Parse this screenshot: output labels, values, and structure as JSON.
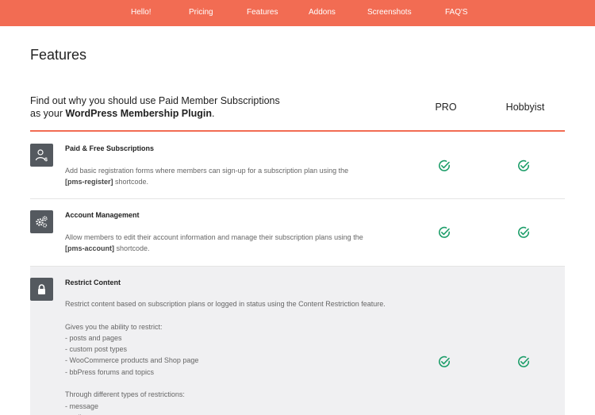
{
  "nav": {
    "items": [
      {
        "label": "Hello!"
      },
      {
        "label": "Pricing"
      },
      {
        "label": "Features"
      },
      {
        "label": "Addons"
      },
      {
        "label": "Screenshots"
      },
      {
        "label": "FAQ'S"
      }
    ]
  },
  "page": {
    "title": "Features"
  },
  "intro": {
    "line1": "Find out why you should use Paid Member Subscriptions",
    "line2_prefix": "as your ",
    "line2_strong": "WordPress Membership Plugin",
    "line2_suffix": "."
  },
  "columns": {
    "pro": "PRO",
    "hobbyist": "Hobbyist"
  },
  "features": [
    {
      "title": "Paid & Free Subscriptions",
      "desc_before": "Add basic registration forms where members can sign-up for a subscription plan using the",
      "shortcode": "[pms-register]",
      "desc_after": " shortcode.",
      "icon": "user-dollar-icon"
    },
    {
      "title": "Account Management",
      "desc_before": "Allow members to edit their account information and manage their subscription plans using the",
      "shortcode": "[pms-account]",
      "desc_after": " shortcode.",
      "icon": "gears-icon"
    },
    {
      "title": "Restrict Content",
      "desc": "Restrict content based on subscription plans or logged in status using the Content Restriction feature.\n\nGives you the ability to restrict:\n- posts and pages\n- custom post types\n- WooCommerce products and Shop page\n- bbPress forums and topics\n\nThrough different types of restrictions:\n- message\n- redirect",
      "icon": "lock-icon"
    }
  ],
  "colors": {
    "accent": "#f26c53",
    "check": "#1e9e6a",
    "icon_bg": "#54595f"
  }
}
